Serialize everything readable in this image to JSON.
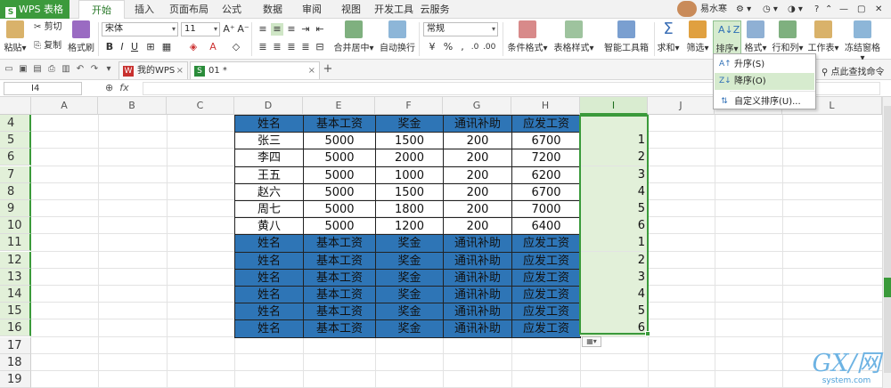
{
  "app": {
    "name": "WPS 表格",
    "accent": "#3c9a3c"
  },
  "menu_tabs": [
    "开始",
    "插入",
    "页面布局",
    "公式",
    "数据",
    "审阅",
    "视图",
    "开发工具",
    "云服务"
  ],
  "active_menu_tab": "开始",
  "top_right": {
    "user": "易水寒",
    "help": "?"
  },
  "ribbon": {
    "paste": "粘贴",
    "cut": "剪切",
    "copy": "复制",
    "format_painter": "格式刷",
    "font_name": "宋体",
    "font_size": "11",
    "merge_center": "合并居中",
    "wrap_text": "自动换行",
    "number_format": "常规",
    "conditional_format": "条件格式",
    "table_style": "表格样式",
    "smart_toolbox": "智能工具箱",
    "sum": "求和",
    "filter": "筛选",
    "sort": "排序",
    "format": "格式",
    "rows_cols": "行和列",
    "worksheet": "工作表",
    "freeze": "冻结窗格",
    "find_cmd": "点此查找命令"
  },
  "doc_tabs": [
    {
      "label": "我的WPS",
      "active": false
    },
    {
      "label": "01 *",
      "active": true
    }
  ],
  "name_box": "I4",
  "fx_label": "fx",
  "columns": [
    "A",
    "B",
    "C",
    "D",
    "E",
    "F",
    "G",
    "H",
    "I",
    "J",
    "K",
    "L"
  ],
  "selected_column": "I",
  "rows": [
    "4",
    "5",
    "6",
    "7",
    "8",
    "9",
    "10",
    "11",
    "12",
    "13",
    "14",
    "15",
    "16",
    "17",
    "18",
    "19"
  ],
  "table": {
    "header": [
      "姓名",
      "基本工资",
      "奖金",
      "通讯补助",
      "应发工资"
    ],
    "records": [
      [
        "张三",
        "5000",
        "1500",
        "200",
        "6700"
      ],
      [
        "李四",
        "5000",
        "2000",
        "200",
        "7200"
      ],
      [
        "王五",
        "5000",
        "1000",
        "200",
        "6200"
      ],
      [
        "赵六",
        "5000",
        "1500",
        "200",
        "6700"
      ],
      [
        "周七",
        "5000",
        "1800",
        "200",
        "7000"
      ],
      [
        "黄八",
        "5000",
        "1200",
        "200",
        "6400"
      ]
    ],
    "repeated_headers": 6,
    "header_fill": "#2e75b6"
  },
  "column_i_values": [
    "",
    "1",
    "2",
    "3",
    "4",
    "5",
    "6",
    "1",
    "2",
    "3",
    "4",
    "5",
    "6"
  ],
  "sort_menu": {
    "items": [
      {
        "label": "升序(S)",
        "icon": "sort-ascending-icon",
        "highlight": false
      },
      {
        "label": "降序(O)",
        "icon": "sort-descending-icon",
        "highlight": true
      },
      {
        "label": "自定义排序(U)...",
        "icon": "custom-sort-icon",
        "highlight": false
      }
    ]
  },
  "watermark": {
    "big": "GX/网",
    "small": "system.com"
  }
}
